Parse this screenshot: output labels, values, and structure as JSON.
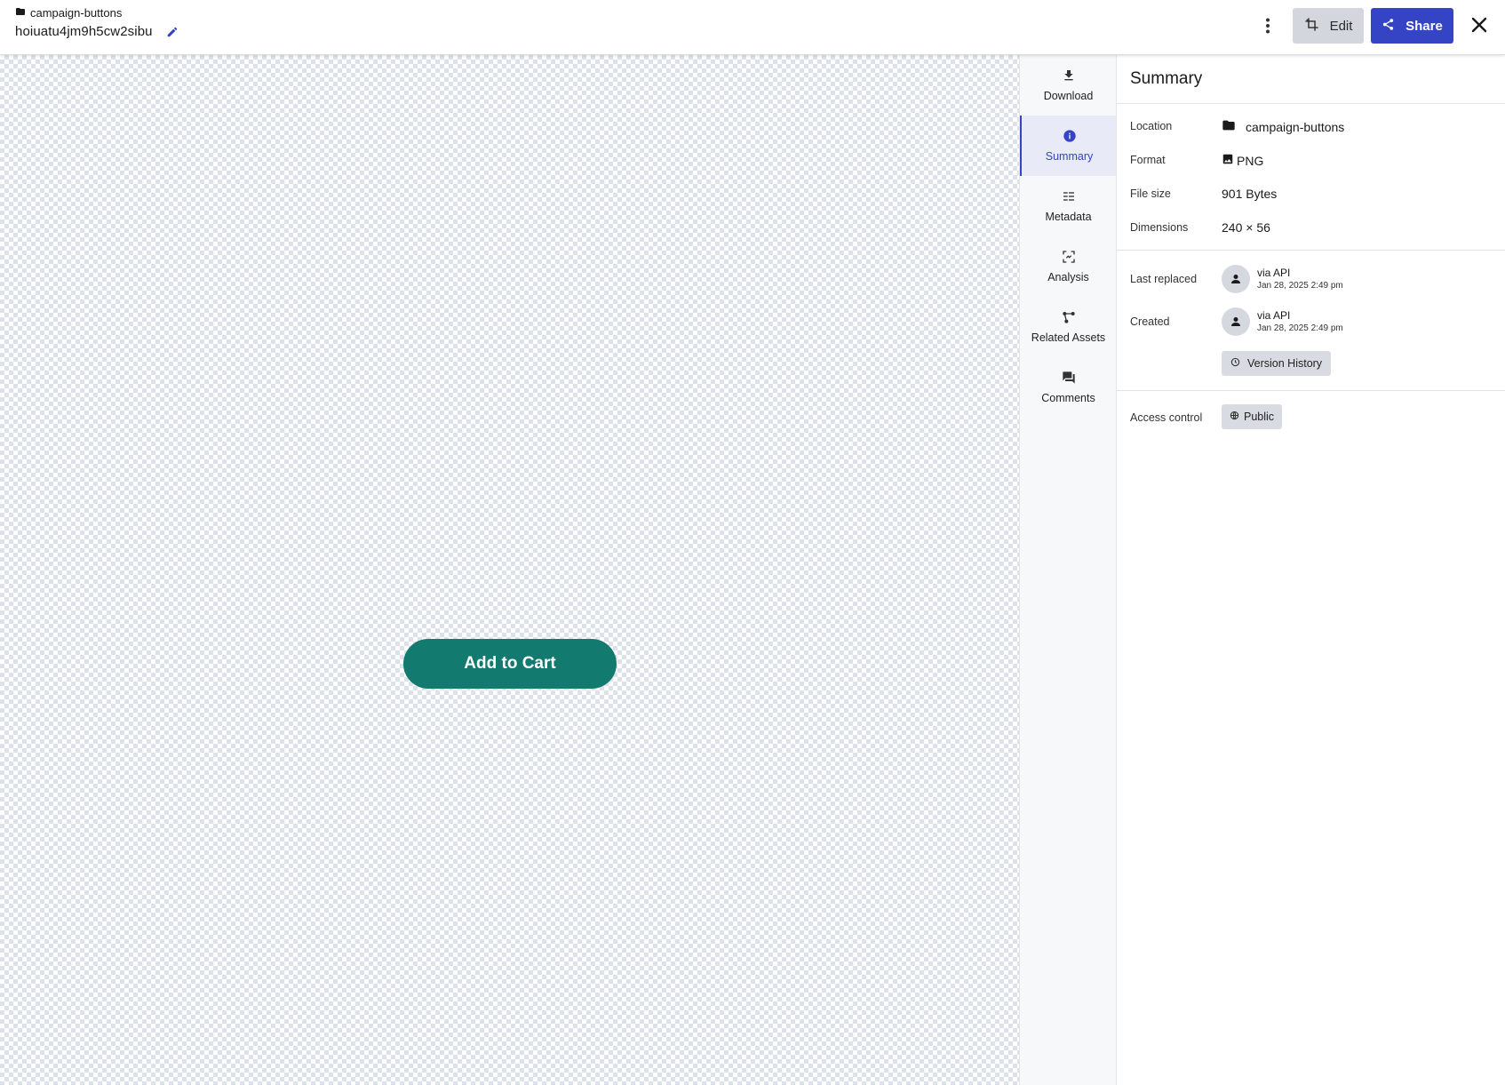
{
  "header": {
    "breadcrumb": "campaign-buttons",
    "asset_name": "hoiuatu4jm9h5cw2sibu",
    "edit_label": "Edit",
    "share_label": "Share"
  },
  "preview": {
    "button_text": "Add to Cart",
    "button_color": "#137a70"
  },
  "rail": {
    "items": [
      {
        "label": "Download",
        "icon": "download-icon"
      },
      {
        "label": "Summary",
        "icon": "info-icon",
        "active": true
      },
      {
        "label": "Metadata",
        "icon": "metadata-icon"
      },
      {
        "label": "Analysis",
        "icon": "analysis-icon"
      },
      {
        "label": "Related Assets",
        "icon": "related-assets-icon"
      },
      {
        "label": "Comments",
        "icon": "comments-icon"
      }
    ]
  },
  "summary": {
    "title": "Summary",
    "location_label": "Location",
    "location_value": "campaign-buttons",
    "format_label": "Format",
    "format_value": "PNG",
    "filesize_label": "File size",
    "filesize_value": "901 Bytes",
    "dimensions_label": "Dimensions",
    "dimensions_value": "240 × 56",
    "last_replaced_label": "Last replaced",
    "last_replaced_by": "via API",
    "last_replaced_date": "Jan 28, 2025 2:49 pm",
    "created_label": "Created",
    "created_by": "via API",
    "created_date": "Jan 28, 2025 2:49 pm",
    "version_history_label": "Version History",
    "access_label": "Access control",
    "access_value": "Public"
  },
  "colors": {
    "accent": "#3444c4",
    "button_grey": "#d3d6dd"
  }
}
